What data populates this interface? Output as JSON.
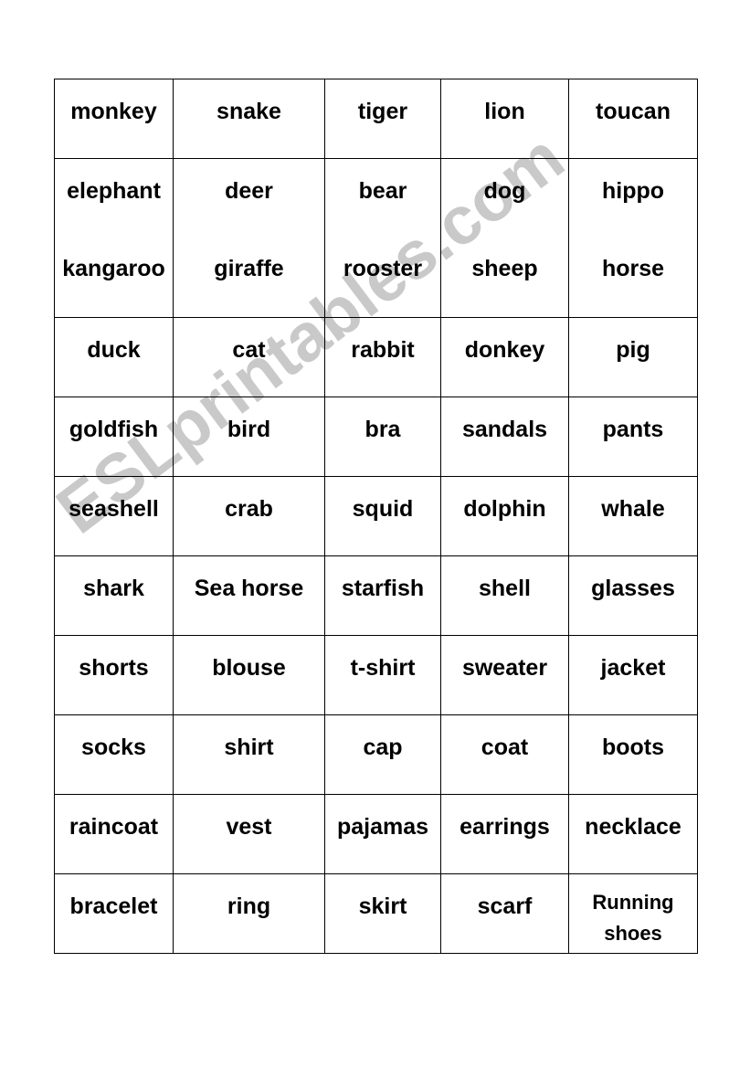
{
  "document": {
    "title": "Vocabulary Bingo Word Grid",
    "page_background": "#ffffff",
    "border_color": "#000000",
    "text_color": "#000000"
  },
  "watermark": {
    "text": "ESLprintables.com",
    "color": "#c9c9c9",
    "rotation_degrees": -37
  },
  "grid": {
    "columns": 5,
    "rows": [
      {
        "type": "single",
        "cells": [
          "monkey",
          "snake",
          "tiger",
          "lion",
          "toucan"
        ]
      },
      {
        "type": "double",
        "cells_line1": [
          "elephant",
          "deer",
          "bear",
          "dog",
          "hippo"
        ],
        "cells_line2": [
          "kangaroo",
          "giraffe",
          "rooster",
          "sheep",
          "horse"
        ]
      },
      {
        "type": "single",
        "cells": [
          "duck",
          "cat",
          "rabbit",
          "donkey",
          "pig"
        ]
      },
      {
        "type": "single",
        "cells": [
          "goldfish",
          "bird",
          "bra",
          "sandals",
          "pants"
        ]
      },
      {
        "type": "single",
        "cells": [
          "seashell",
          "crab",
          "squid",
          "dolphin",
          "whale"
        ]
      },
      {
        "type": "single",
        "cells": [
          "shark",
          "Sea horse",
          "starfish",
          "shell",
          "glasses"
        ]
      },
      {
        "type": "single",
        "cells": [
          "shorts",
          "blouse",
          "t-shirt",
          "sweater",
          "jacket"
        ]
      },
      {
        "type": "single",
        "cells": [
          "socks",
          "shirt",
          "cap",
          "coat",
          "boots"
        ]
      },
      {
        "type": "single",
        "cells": [
          "raincoat",
          "vest",
          "pajamas",
          "earrings",
          "necklace"
        ]
      },
      {
        "type": "single",
        "cells": [
          "bracelet",
          "ring",
          "skirt",
          "scarf",
          "Running shoes"
        ]
      }
    ]
  }
}
